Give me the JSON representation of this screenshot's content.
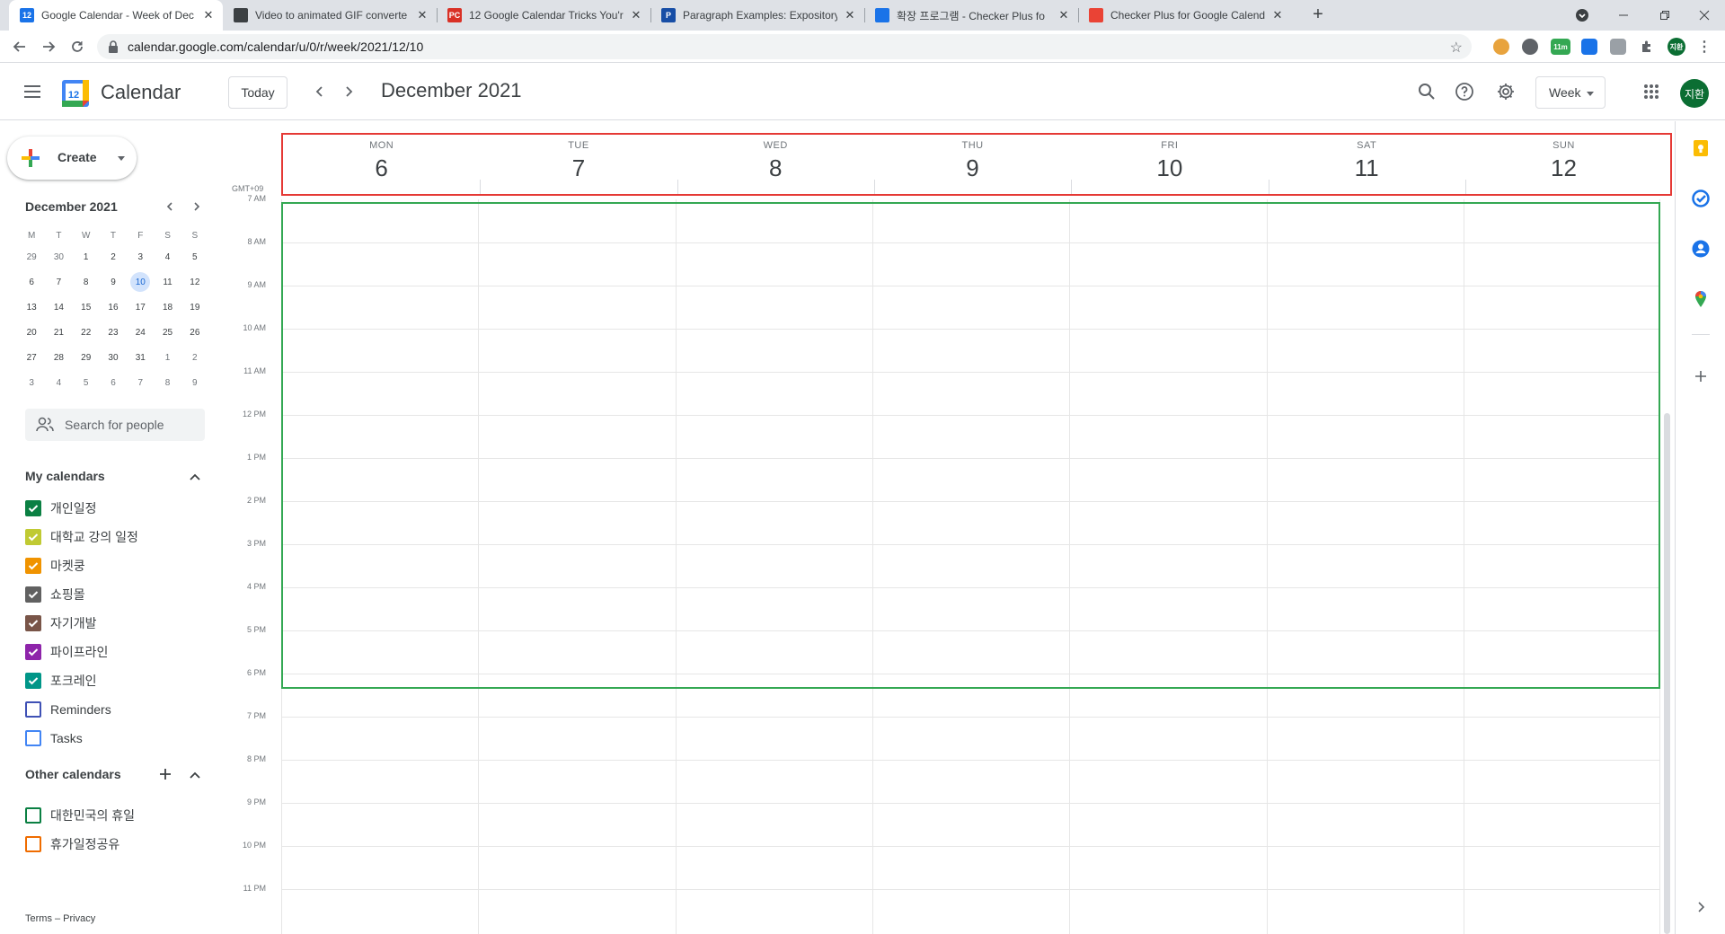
{
  "browser": {
    "tabs": [
      {
        "title": "Google Calendar - Week of Dec",
        "favicon_text": "12",
        "favicon_color": "#1a73e8",
        "active": true
      },
      {
        "title": "Video to animated GIF converte",
        "favicon_text": "",
        "favicon_color": "#3c4043",
        "active": false
      },
      {
        "title": "12 Google Calendar Tricks You'r",
        "favicon_text": "PC",
        "favicon_color": "#d93025",
        "active": false
      },
      {
        "title": "Paragraph Examples: Expository",
        "favicon_text": "P",
        "favicon_color": "#174ea6",
        "active": false
      },
      {
        "title": "확장 프로그램 - Checker Plus fo",
        "favicon_text": "",
        "favicon_color": "#1a73e8",
        "active": false
      },
      {
        "title": "Checker Plus for Google Calend",
        "favicon_text": "",
        "favicon_color": "#ea4335",
        "active": false
      }
    ],
    "url": "calendar.google.com/calendar/u/0/r/week/2021/12/10",
    "extension_badge": "11m",
    "profile_initials": "지환"
  },
  "header": {
    "app_title": "Calendar",
    "logo_day": "12",
    "today_label": "Today",
    "period": "December 2021",
    "view_label": "Week",
    "avatar_initials": "지환"
  },
  "sidebar": {
    "create_label": "Create",
    "mini_calendar": {
      "title": "December 2021",
      "weekdays": [
        "M",
        "T",
        "W",
        "T",
        "F",
        "S",
        "S"
      ],
      "weeks": [
        [
          "29",
          "30",
          "1",
          "2",
          "3",
          "4",
          "5"
        ],
        [
          "6",
          "7",
          "8",
          "9",
          "10",
          "11",
          "12"
        ],
        [
          "13",
          "14",
          "15",
          "16",
          "17",
          "18",
          "19"
        ],
        [
          "20",
          "21",
          "22",
          "23",
          "24",
          "25",
          "26"
        ],
        [
          "27",
          "28",
          "29",
          "30",
          "31",
          "1",
          "2"
        ],
        [
          "3",
          "4",
          "5",
          "6",
          "7",
          "8",
          "9"
        ]
      ],
      "today": "10"
    },
    "people_search_placeholder": "Search for people",
    "my_calendars_title": "My calendars",
    "my_calendars": [
      {
        "name": "개인일정",
        "color": "#0b8043",
        "checked": true
      },
      {
        "name": "대학교 강의 일정",
        "color": "#c0ca33",
        "checked": true
      },
      {
        "name": "마켓쿵",
        "color": "#f09300",
        "checked": true
      },
      {
        "name": "쇼핑몰",
        "color": "#616161",
        "checked": true
      },
      {
        "name": "자기개발",
        "color": "#795548",
        "checked": true
      },
      {
        "name": "파이프라인",
        "color": "#8e24aa",
        "checked": true
      },
      {
        "name": "포크레인",
        "color": "#009688",
        "checked": true
      },
      {
        "name": "Reminders",
        "color": "#3f51b5",
        "checked": false
      },
      {
        "name": "Tasks",
        "color": "#4285f4",
        "checked": false
      }
    ],
    "other_calendars_title": "Other calendars",
    "other_calendars": [
      {
        "name": "대한민국의 휴일",
        "color": "#0b8043",
        "checked": false
      },
      {
        "name": "휴가일정공유",
        "color": "#ef6c00",
        "checked": false
      }
    ],
    "footer": "Terms – Privacy"
  },
  "week": {
    "timezone": "GMT+09",
    "days": [
      {
        "dow": "MON",
        "date": "6"
      },
      {
        "dow": "TUE",
        "date": "7"
      },
      {
        "dow": "WED",
        "date": "8"
      },
      {
        "dow": "THU",
        "date": "9"
      },
      {
        "dow": "FRI",
        "date": "10"
      },
      {
        "dow": "SAT",
        "date": "11"
      },
      {
        "dow": "SUN",
        "date": "12"
      }
    ],
    "hours": [
      "7 AM",
      "8 AM",
      "9 AM",
      "10 AM",
      "11 AM",
      "12 PM",
      "1 PM",
      "2 PM",
      "3 PM",
      "4 PM",
      "5 PM",
      "6 PM",
      "7 PM",
      "8 PM",
      "9 PM",
      "10 PM",
      "11 PM"
    ],
    "highlight_colors": {
      "day_header_box": "#e53935",
      "working_hours_box": "#34a853"
    }
  }
}
